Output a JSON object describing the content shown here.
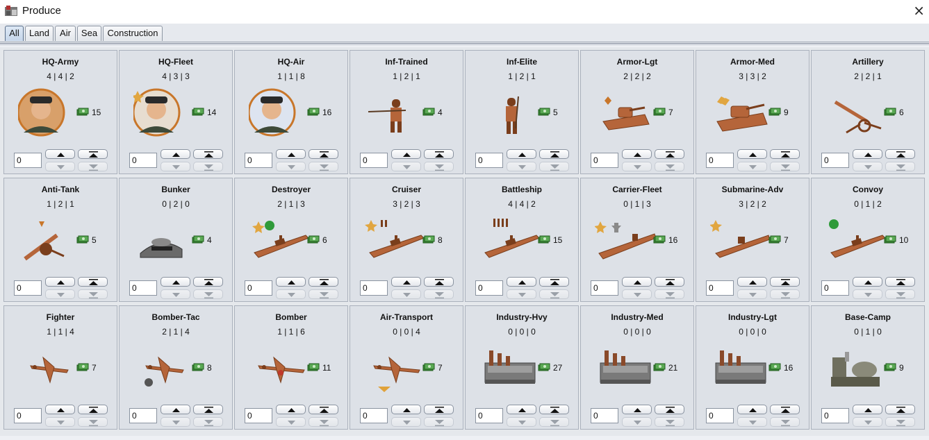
{
  "window": {
    "title": "Produce",
    "close_glyph": "×"
  },
  "tabs": [
    {
      "label": "All",
      "active": true
    },
    {
      "label": "Land",
      "active": false
    },
    {
      "label": "Air",
      "active": false
    },
    {
      "label": "Sea",
      "active": false
    },
    {
      "label": "Construction",
      "active": false
    }
  ],
  "units": [
    {
      "name": "HQ-Army",
      "stats": "4 | 4 | 2",
      "cost": "15",
      "qty": "0",
      "icon": "army-general-portrait-icon"
    },
    {
      "name": "HQ-Fleet",
      "stats": "4 | 3 | 3",
      "cost": "14",
      "qty": "0",
      "icon": "fleet-admiral-portrait-icon"
    },
    {
      "name": "HQ-Air",
      "stats": "1 | 1 | 8",
      "cost": "16",
      "qty": "0",
      "icon": "air-commander-portrait-icon"
    },
    {
      "name": "Inf-Trained",
      "stats": "1 | 2 | 1",
      "cost": "4",
      "qty": "0",
      "icon": "trained-infantry-icon"
    },
    {
      "name": "Inf-Elite",
      "stats": "1 | 2 | 1",
      "cost": "5",
      "qty": "0",
      "icon": "elite-infantry-icon"
    },
    {
      "name": "Armor-Lgt",
      "stats": "2 | 2 | 2",
      "cost": "7",
      "qty": "0",
      "icon": "light-tank-icon"
    },
    {
      "name": "Armor-Med",
      "stats": "3 | 3 | 2",
      "cost": "9",
      "qty": "0",
      "icon": "medium-tank-icon"
    },
    {
      "name": "Artillery",
      "stats": "2 | 2 | 1",
      "cost": "6",
      "qty": "0",
      "icon": "artillery-gun-icon"
    },
    {
      "name": "Anti-Tank",
      "stats": "1 | 2 | 1",
      "cost": "5",
      "qty": "0",
      "icon": "anti-tank-gun-icon"
    },
    {
      "name": "Bunker",
      "stats": "0 | 2 | 0",
      "cost": "4",
      "qty": "0",
      "icon": "bunker-icon"
    },
    {
      "name": "Destroyer",
      "stats": "2 | 1 | 3",
      "cost": "6",
      "qty": "0",
      "icon": "destroyer-ship-icon"
    },
    {
      "name": "Cruiser",
      "stats": "3 | 2 | 3",
      "cost": "8",
      "qty": "0",
      "icon": "cruiser-ship-icon"
    },
    {
      "name": "Battleship",
      "stats": "4 | 4 | 2",
      "cost": "15",
      "qty": "0",
      "icon": "battleship-icon"
    },
    {
      "name": "Carrier-Fleet",
      "stats": "0 | 1 | 3",
      "cost": "16",
      "qty": "0",
      "icon": "aircraft-carrier-icon"
    },
    {
      "name": "Submarine-Adv",
      "stats": "3 | 2 | 2",
      "cost": "7",
      "qty": "0",
      "icon": "submarine-icon"
    },
    {
      "name": "Convoy",
      "stats": "0 | 1 | 2",
      "cost": "10",
      "qty": "0",
      "icon": "convoy-ship-icon"
    },
    {
      "name": "Fighter",
      "stats": "1 | 1 | 4",
      "cost": "7",
      "qty": "0",
      "icon": "fighter-plane-icon"
    },
    {
      "name": "Bomber-Tac",
      "stats": "2 | 1 | 4",
      "cost": "8",
      "qty": "0",
      "icon": "tactical-bomber-icon"
    },
    {
      "name": "Bomber",
      "stats": "1 | 1 | 6",
      "cost": "11",
      "qty": "0",
      "icon": "bomber-plane-icon"
    },
    {
      "name": "Air-Transport",
      "stats": "0 | 0 | 4",
      "cost": "7",
      "qty": "0",
      "icon": "transport-plane-icon"
    },
    {
      "name": "Industry-Hvy",
      "stats": "0 | 0 | 0",
      "cost": "27",
      "qty": "0",
      "icon": "heavy-factory-icon"
    },
    {
      "name": "Industry-Med",
      "stats": "0 | 0 | 0",
      "cost": "21",
      "qty": "0",
      "icon": "medium-factory-icon"
    },
    {
      "name": "Industry-Lgt",
      "stats": "0 | 0 | 0",
      "cost": "16",
      "qty": "0",
      "icon": "light-factory-icon"
    },
    {
      "name": "Base-Camp",
      "stats": "0 | 1 | 0",
      "cost": "9",
      "qty": "0",
      "icon": "base-camp-icon"
    }
  ],
  "colors": {
    "bronze": "#b5653a",
    "bronze_dark": "#7a3e1c",
    "money_green": "#3f8f3a",
    "panel": "#dde1e7",
    "badge_gold": "#e1a640",
    "badge_green": "#2f9a3a"
  }
}
